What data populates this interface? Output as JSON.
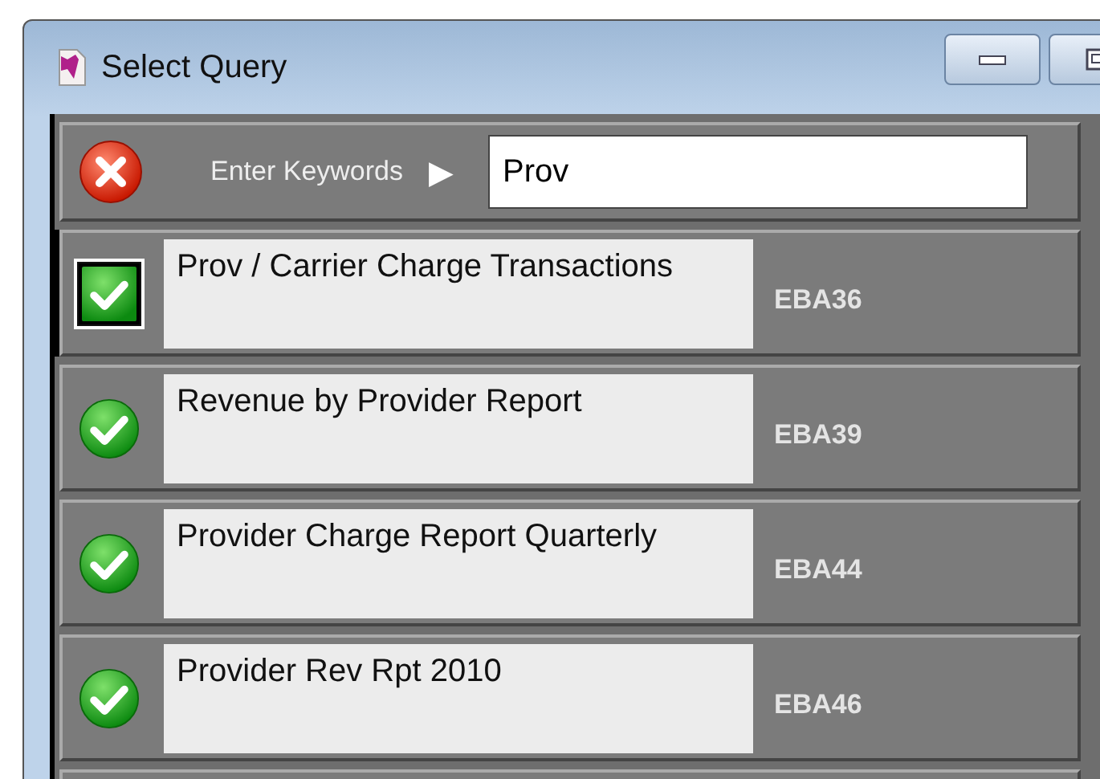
{
  "window": {
    "title": "Select Query"
  },
  "search": {
    "label": "Enter Keywords",
    "arrow": "▶",
    "value": "Prov"
  },
  "rows": [
    {
      "title": "Prov / Carrier Charge Transactions",
      "code": "EBA36",
      "selected": true
    },
    {
      "title": "Revenue by Provider Report",
      "code": "EBA39",
      "selected": false
    },
    {
      "title": "Provider Charge Report Quarterly",
      "code": "EBA44",
      "selected": false
    },
    {
      "title": "Provider Rev Rpt 2010",
      "code": "EBA46",
      "selected": false
    }
  ]
}
